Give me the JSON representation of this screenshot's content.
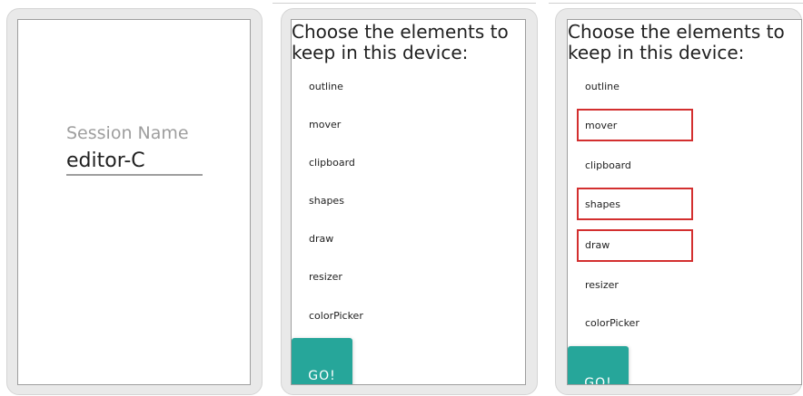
{
  "session_screen": {
    "label": "Session Name",
    "value": "editor-C"
  },
  "element_picker_unselected": {
    "heading": "Choose the elements to keep in this device:",
    "items": [
      "outline",
      "mover",
      "clipboard",
      "shapes",
      "draw",
      "resizer",
      "colorPicker"
    ],
    "go_label": "GO!"
  },
  "element_picker_selected": {
    "heading": "Choose the elements to keep in this device:",
    "items": [
      "outline",
      "mover",
      "clipboard",
      "shapes",
      "draw",
      "resizer",
      "colorPicker"
    ],
    "selected": [
      "mover",
      "shapes",
      "draw"
    ],
    "go_label": "GO!"
  },
  "colors": {
    "go_button": "#26a69a",
    "selection_outline": "#d32f2f"
  }
}
